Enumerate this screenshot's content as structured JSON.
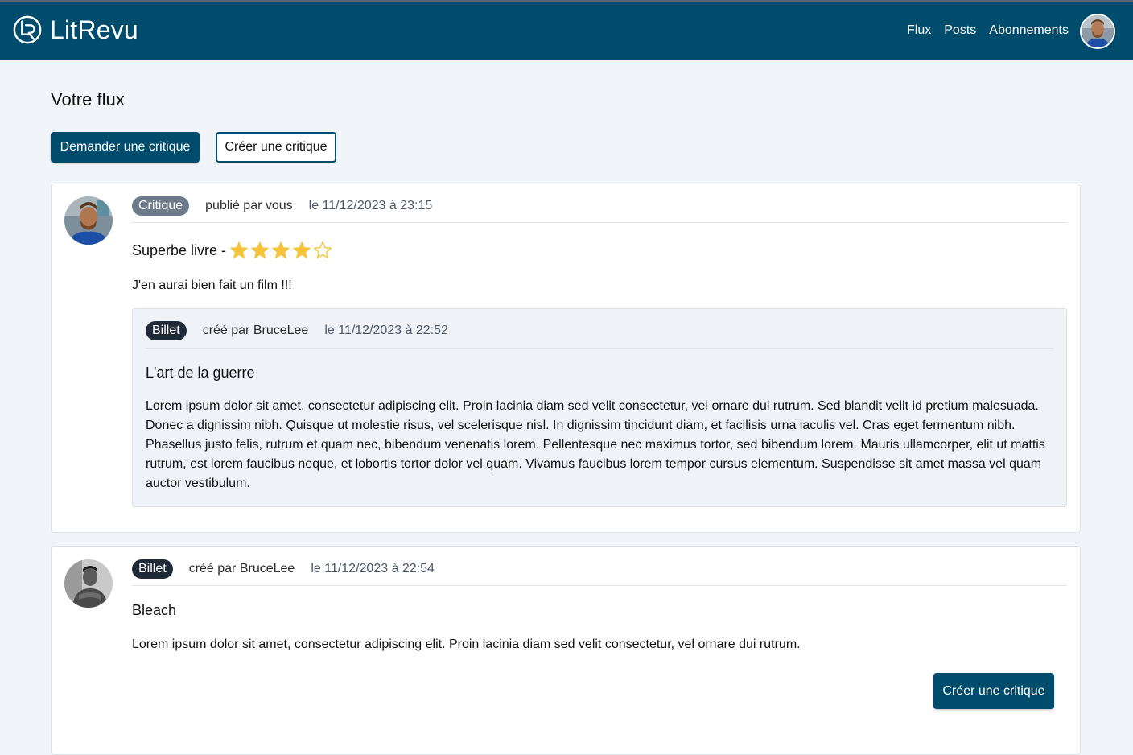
{
  "brand": {
    "name": "LitRevu"
  },
  "nav": {
    "items": [
      {
        "label": "Flux"
      },
      {
        "label": "Posts"
      },
      {
        "label": "Abonnements"
      }
    ]
  },
  "page": {
    "title": "Votre flux",
    "request_button": "Demander une critique",
    "create_button": "Créer une critique"
  },
  "feed": [
    {
      "badge": "Critique",
      "author": "publié par vous",
      "date": "le 11/12/2023 à 23:15",
      "headline": "Superbe livre -",
      "rating": 4,
      "rating_max": 5,
      "body": "J'en aurai bien fait un film !!!",
      "ticket": {
        "badge": "Billet",
        "author": "créé par BruceLee",
        "date": "le 11/12/2023 à 22:52",
        "title": "L'art de la guerre",
        "description": "Lorem ipsum dolor sit amet, consectetur adipiscing elit. Proin lacinia diam sed velit consectetur, vel ornare dui rutrum. Sed blandit velit id pretium malesuada. Donec a dignissim nibh. Quisque ut molestie risus, vel scelerisque nisl. In dignissim tincidunt diam, et facilisis urna iaculis vel. Cras eget fermentum nibh. Phasellus justo felis, rutrum et quam nec, bibendum venenatis lorem. Pellentesque nec maximus tortor, sed bibendum lorem. Mauris ullamcorper, elit ut mattis rutrum, est lorem faucibus neque, et lobortis tortor dolor vel quam. Vivamus faucibus lorem tempor cursus elementum. Suspendisse sit amet massa vel quam auctor vestibulum."
      }
    },
    {
      "badge": "Billet",
      "author": "créé par BruceLee",
      "date": "le 11/12/2023 à 22:54",
      "title": "Bleach",
      "description": "Lorem ipsum dolor sit amet, consectetur adipiscing elit. Proin lacinia diam sed velit consectetur, vel ornare dui rutrum.",
      "action_button": "Créer une critique"
    }
  ],
  "colors": {
    "navbar": "#004c6d",
    "star": "#f5c43a",
    "badge_critique": "#6c7a89",
    "badge_billet": "#1e2a38"
  }
}
